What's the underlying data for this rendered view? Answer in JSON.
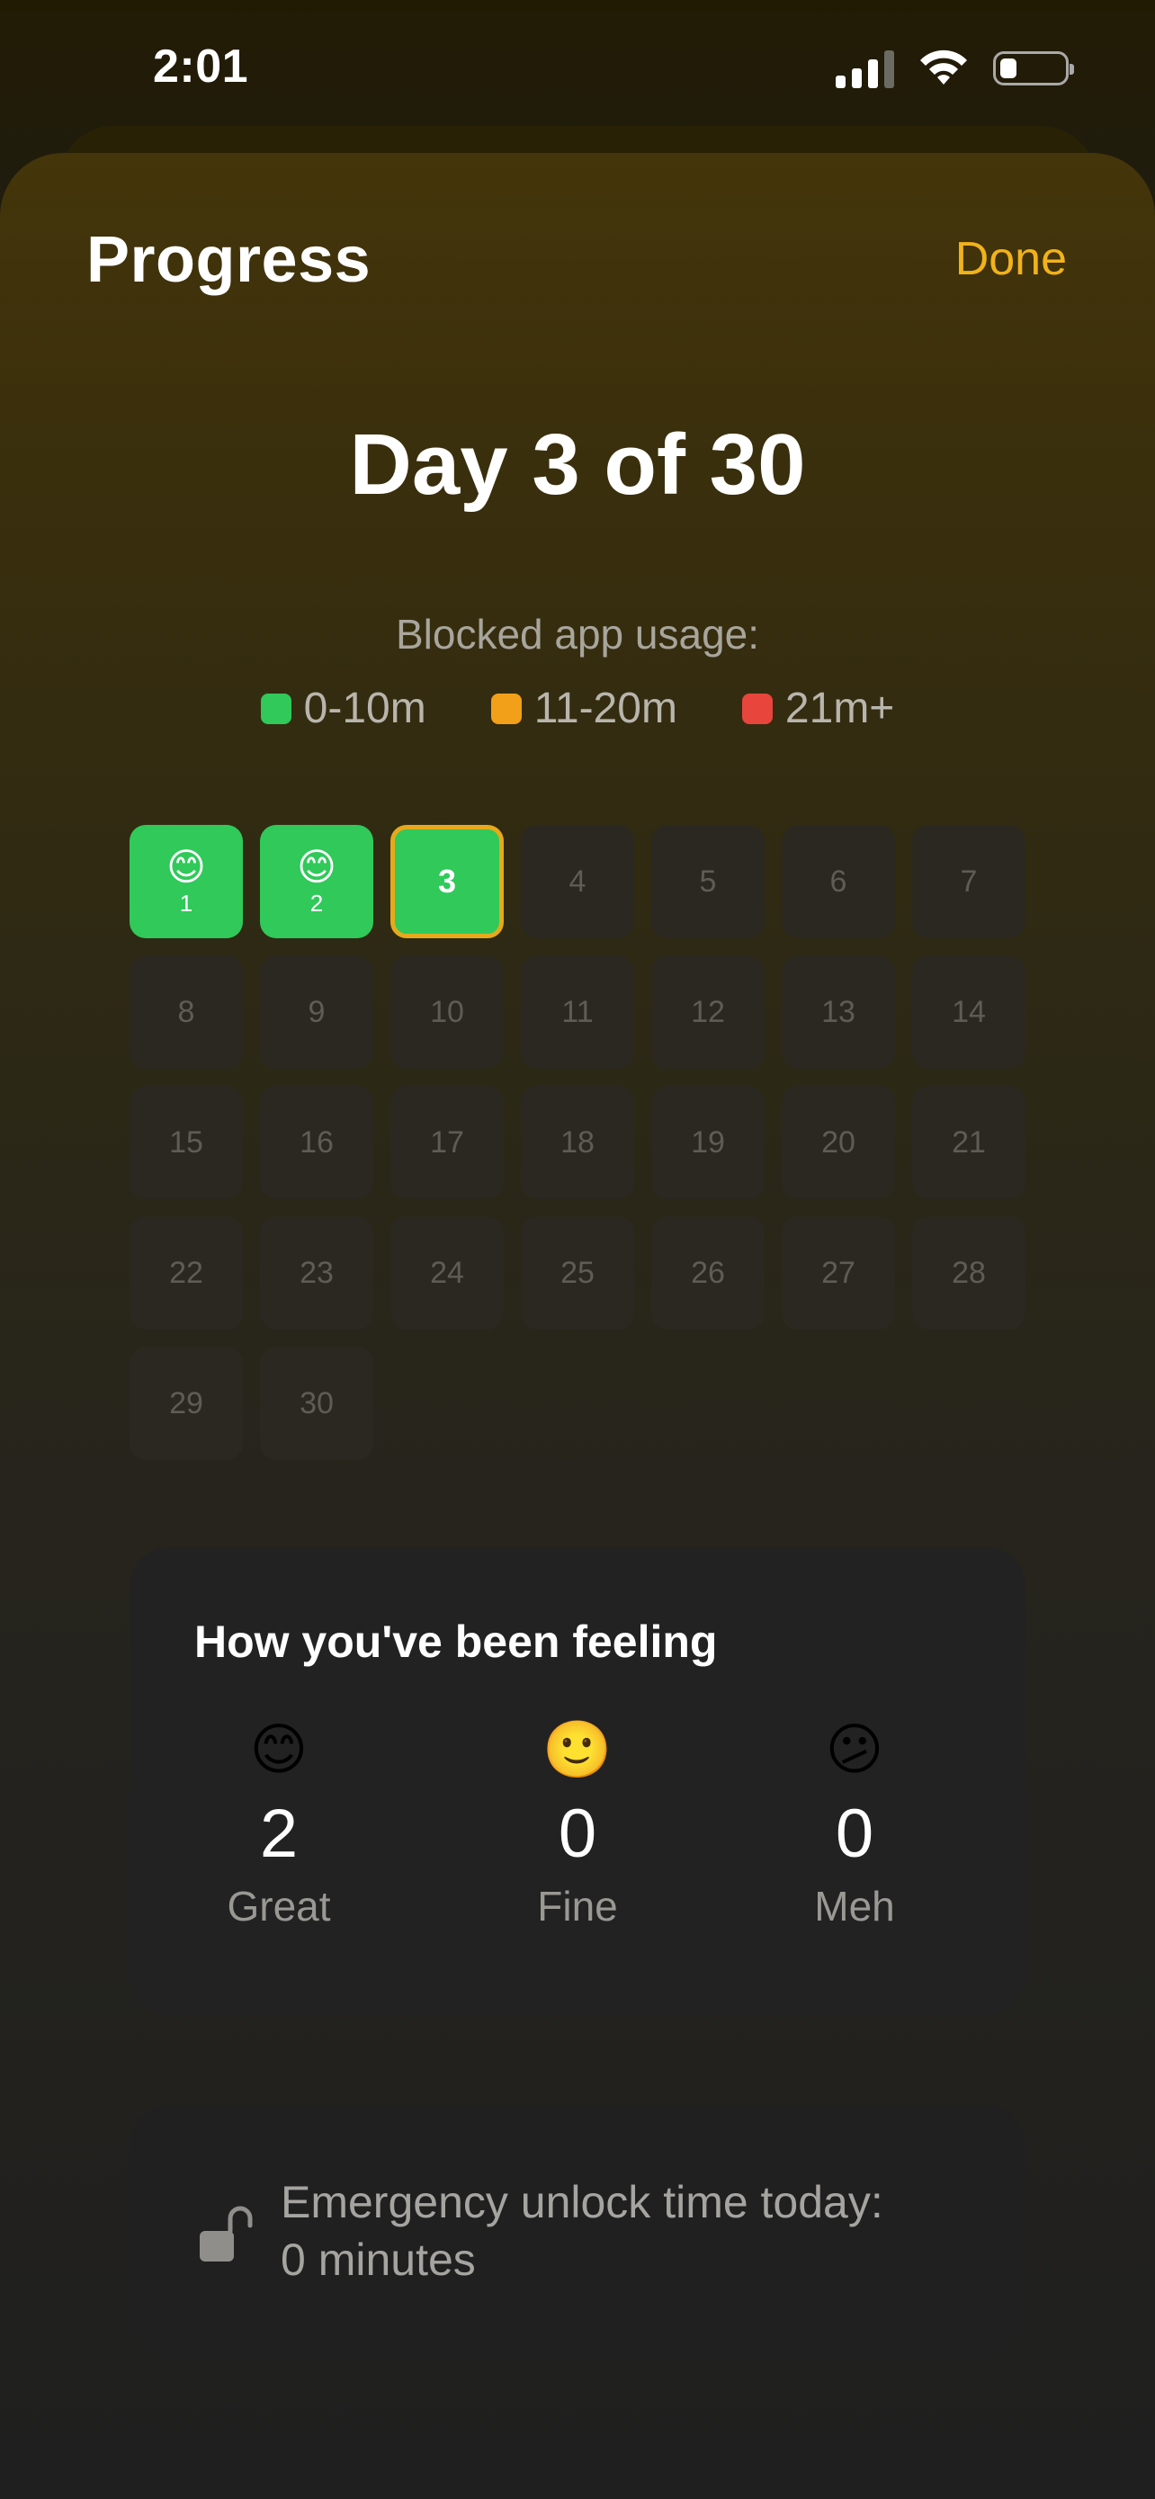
{
  "status_bar": {
    "time": "2:01",
    "icons": [
      "signal-icon",
      "wifi-icon",
      "battery-icon"
    ]
  },
  "header": {
    "title": "Progress",
    "done_label": "Done"
  },
  "day_title": "Day 3 of 30",
  "legend": {
    "title": "Blocked app usage:",
    "items": [
      {
        "label": "0-10m",
        "color": "#30c95a"
      },
      {
        "label": "11-20m",
        "color": "#f2a01a"
      },
      {
        "label": "21m+",
        "color": "#e8453c"
      }
    ]
  },
  "calendar": {
    "days": [
      {
        "day": "1",
        "emoji": "😊",
        "status": "done"
      },
      {
        "day": "2",
        "emoji": "😊",
        "status": "done"
      },
      {
        "day": "3",
        "status": "today"
      },
      {
        "day": "4"
      },
      {
        "day": "5"
      },
      {
        "day": "6"
      },
      {
        "day": "7"
      },
      {
        "day": "8"
      },
      {
        "day": "9"
      },
      {
        "day": "10"
      },
      {
        "day": "11"
      },
      {
        "day": "12"
      },
      {
        "day": "13"
      },
      {
        "day": "14"
      },
      {
        "day": "15"
      },
      {
        "day": "16"
      },
      {
        "day": "17"
      },
      {
        "day": "18"
      },
      {
        "day": "19"
      },
      {
        "day": "20"
      },
      {
        "day": "21"
      },
      {
        "day": "22"
      },
      {
        "day": "23"
      },
      {
        "day": "24"
      },
      {
        "day": "25"
      },
      {
        "day": "26"
      },
      {
        "day": "27"
      },
      {
        "day": "28"
      },
      {
        "day": "29"
      },
      {
        "day": "30"
      }
    ]
  },
  "feeling": {
    "title": "How you've been feeling",
    "items": [
      {
        "emoji": "😊",
        "count": "2",
        "label": "Great"
      },
      {
        "emoji": "🙂",
        "count": "0",
        "label": "Fine"
      },
      {
        "emoji": "😕",
        "count": "0",
        "label": "Meh"
      }
    ]
  },
  "emergency": {
    "line1": "Emergency unlock time today:",
    "line2": "0 minutes"
  }
}
